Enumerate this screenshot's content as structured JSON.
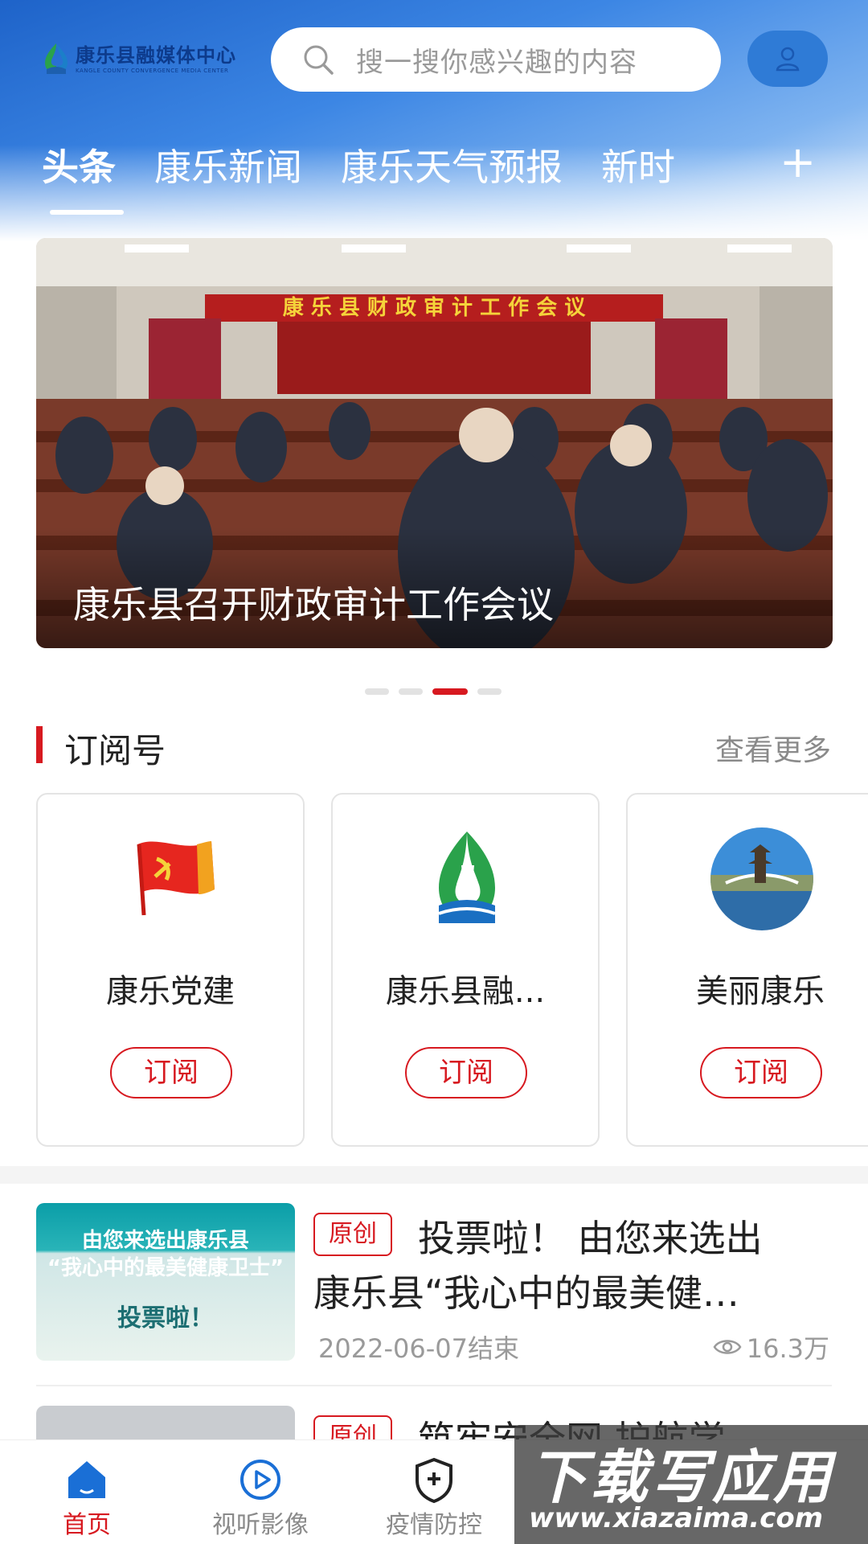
{
  "header": {
    "logo_cn": "康乐县融媒体中心",
    "logo_en": "KANGLE COUNTY CONVERGENCE MEDIA CENTER",
    "search_placeholder": "搜一搜你感兴趣的内容"
  },
  "tabs": [
    "头条",
    "康乐新闻",
    "康乐天气预报",
    "新时"
  ],
  "tab_add": "+",
  "banner": {
    "caption": "康乐县召开财政审计工作会议",
    "sign_text": "康 乐 县 财 政 审 计 工 作 会 议",
    "dots": 4,
    "active_dot": 3
  },
  "subscriptions": {
    "title": "订阅号",
    "more": "查看更多",
    "items": [
      {
        "name": "康乐党建",
        "button": "订阅",
        "icon": "party-flag-icon"
      },
      {
        "name": "康乐县融...",
        "button": "订阅",
        "icon": "media-center-logo-icon"
      },
      {
        "name": "美丽康乐",
        "button": "订阅",
        "icon": "scenic-photo-icon"
      }
    ]
  },
  "news": [
    {
      "tag": "原创",
      "title_line1": "投票啦！ 由您来选出",
      "title_line2": "康乐县“我心中的最美健…",
      "date": "2022-06-07结束",
      "views": "16.3万",
      "thumb_line1": "由您来选出康乐县",
      "thumb_line2": "“我心中的最美健康卫士”",
      "thumb_line3": "投票啦！"
    },
    {
      "tag": "原创",
      "title_line1": "筑牢安全网 护航学"
    }
  ],
  "nav": [
    {
      "label": "首页",
      "icon": "home-icon",
      "active": true
    },
    {
      "label": "视听影像",
      "icon": "play-icon",
      "active": false
    },
    {
      "label": "疫情防控",
      "icon": "shield-plus-icon",
      "active": false
    },
    {
      "label": "",
      "icon": "service-icon",
      "active": false
    },
    {
      "label": "",
      "icon": "profile-icon",
      "active": false
    }
  ],
  "watermark": {
    "main": "下载写应用",
    "url": "www.xiazaima.com"
  },
  "colors": {
    "accent": "#d71920",
    "header_blue": "#1e63c9"
  }
}
